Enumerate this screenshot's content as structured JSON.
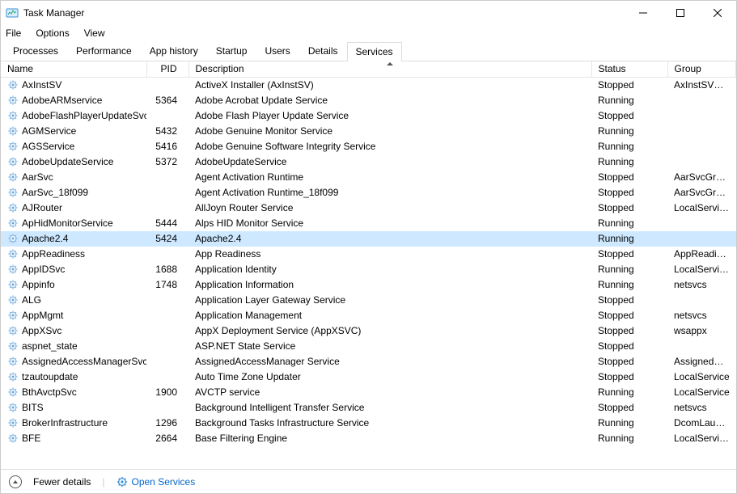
{
  "title": "Task Manager",
  "menus": {
    "file": "File",
    "options": "Options",
    "view": "View"
  },
  "tabs": [
    {
      "label": "Processes"
    },
    {
      "label": "Performance"
    },
    {
      "label": "App history"
    },
    {
      "label": "Startup"
    },
    {
      "label": "Users"
    },
    {
      "label": "Details"
    },
    {
      "label": "Services",
      "active": true
    }
  ],
  "columns": {
    "name": "Name",
    "pid": "PID",
    "description": "Description",
    "status": "Status",
    "group": "Group"
  },
  "rows": [
    {
      "name": "AxInstSV",
      "pid": "",
      "description": "ActiveX Installer (AxInstSV)",
      "status": "Stopped",
      "group": "AxInstSVGroup"
    },
    {
      "name": "AdobeARMservice",
      "pid": "5364",
      "description": "Adobe Acrobat Update Service",
      "status": "Running",
      "group": ""
    },
    {
      "name": "AdobeFlashPlayerUpdateSvc",
      "pid": "",
      "description": "Adobe Flash Player Update Service",
      "status": "Stopped",
      "group": ""
    },
    {
      "name": "AGMService",
      "pid": "5432",
      "description": "Adobe Genuine Monitor Service",
      "status": "Running",
      "group": ""
    },
    {
      "name": "AGSService",
      "pid": "5416",
      "description": "Adobe Genuine Software Integrity Service",
      "status": "Running",
      "group": ""
    },
    {
      "name": "AdobeUpdateService",
      "pid": "5372",
      "description": "AdobeUpdateService",
      "status": "Running",
      "group": ""
    },
    {
      "name": "AarSvc",
      "pid": "",
      "description": "Agent Activation Runtime",
      "status": "Stopped",
      "group": "AarSvcGroup"
    },
    {
      "name": "AarSvc_18f099",
      "pid": "",
      "description": "Agent Activation Runtime_18f099",
      "status": "Stopped",
      "group": "AarSvcGroup"
    },
    {
      "name": "AJRouter",
      "pid": "",
      "description": "AllJoyn Router Service",
      "status": "Stopped",
      "group": "LocalServiceN..."
    },
    {
      "name": "ApHidMonitorService",
      "pid": "5444",
      "description": "Alps HID Monitor Service",
      "status": "Running",
      "group": ""
    },
    {
      "name": "Apache2.4",
      "pid": "5424",
      "description": "Apache2.4",
      "status": "Running",
      "group": "",
      "selected": true
    },
    {
      "name": "AppReadiness",
      "pid": "",
      "description": "App Readiness",
      "status": "Stopped",
      "group": "AppReadiness"
    },
    {
      "name": "AppIDSvc",
      "pid": "1688",
      "description": "Application Identity",
      "status": "Running",
      "group": "LocalServiceN..."
    },
    {
      "name": "Appinfo",
      "pid": "1748",
      "description": "Application Information",
      "status": "Running",
      "group": "netsvcs"
    },
    {
      "name": "ALG",
      "pid": "",
      "description": "Application Layer Gateway Service",
      "status": "Stopped",
      "group": ""
    },
    {
      "name": "AppMgmt",
      "pid": "",
      "description": "Application Management",
      "status": "Stopped",
      "group": "netsvcs"
    },
    {
      "name": "AppXSvc",
      "pid": "",
      "description": "AppX Deployment Service (AppXSVC)",
      "status": "Stopped",
      "group": "wsappx"
    },
    {
      "name": "aspnet_state",
      "pid": "",
      "description": "ASP.NET State Service",
      "status": "Stopped",
      "group": ""
    },
    {
      "name": "AssignedAccessManagerSvc",
      "pid": "",
      "description": "AssignedAccessManager Service",
      "status": "Stopped",
      "group": "AssignedAcce..."
    },
    {
      "name": "tzautoupdate",
      "pid": "",
      "description": "Auto Time Zone Updater",
      "status": "Stopped",
      "group": "LocalService"
    },
    {
      "name": "BthAvctpSvc",
      "pid": "1900",
      "description": "AVCTP service",
      "status": "Running",
      "group": "LocalService"
    },
    {
      "name": "BITS",
      "pid": "",
      "description": "Background Intelligent Transfer Service",
      "status": "Stopped",
      "group": "netsvcs"
    },
    {
      "name": "BrokerInfrastructure",
      "pid": "1296",
      "description": "Background Tasks Infrastructure Service",
      "status": "Running",
      "group": "DcomLaunch"
    },
    {
      "name": "BFE",
      "pid": "2664",
      "description": "Base Filtering Engine",
      "status": "Running",
      "group": "LocalServiceN..."
    }
  ],
  "footer": {
    "fewer": "Fewer details",
    "open_services": "Open Services"
  }
}
